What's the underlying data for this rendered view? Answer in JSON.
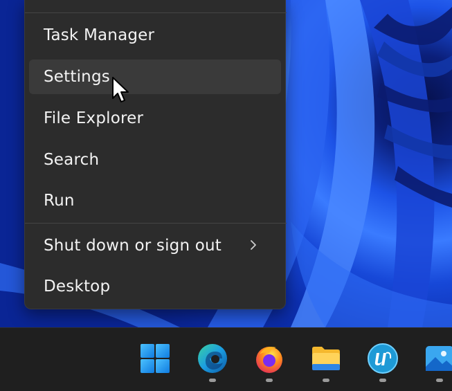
{
  "menu": {
    "items": [
      {
        "label": "Task Manager"
      },
      {
        "label": "Settings"
      },
      {
        "label": "File Explorer"
      },
      {
        "label": "Search"
      },
      {
        "label": "Run"
      },
      {
        "label": "Shut down or sign out"
      },
      {
        "label": "Desktop"
      }
    ],
    "hovered_item": "Settings"
  },
  "taskbar": {
    "icons": [
      {
        "name": "windows-start-icon",
        "running": false
      },
      {
        "name": "edge-browser-icon",
        "running": true
      },
      {
        "name": "firefox-icon",
        "running": true
      },
      {
        "name": "file-explorer-icon",
        "running": true
      },
      {
        "name": "blue-u-app-icon",
        "running": true
      },
      {
        "name": "photos-icon",
        "running": true
      }
    ]
  },
  "colors": {
    "menu_bg": "#2c2c2c",
    "menu_hover": "#3a3a3a",
    "taskbar_bg": "#1f1f1f",
    "accent_blue": "#1c52e6"
  }
}
